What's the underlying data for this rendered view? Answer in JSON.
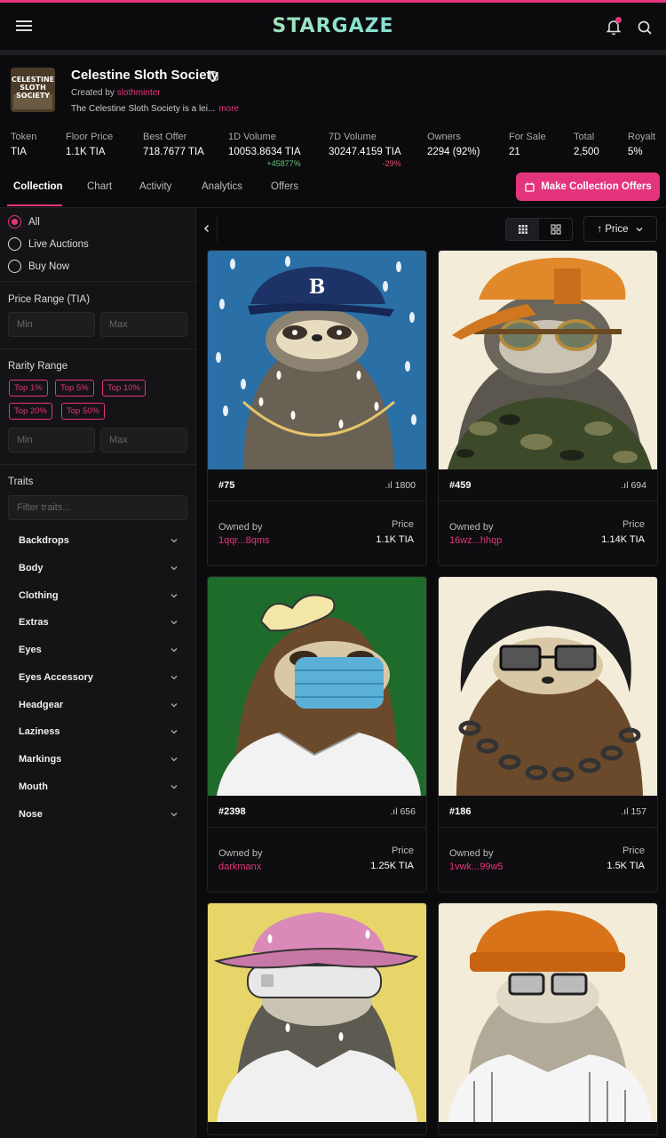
{
  "app": {
    "logo": "STARGAZE"
  },
  "collection": {
    "name": "Celestine Sloth Society",
    "created_by_label": "Created by",
    "creator": "slothminter",
    "description": "The Celestine Sloth Society is a lei...",
    "more_label": "more",
    "avatar_text": "CELESTINE SLOTH SOCIETY"
  },
  "stats": [
    {
      "label": "Token",
      "value": "TIA",
      "change": ""
    },
    {
      "label": "Floor Price",
      "value": "1.1K TIA",
      "change": ""
    },
    {
      "label": "Best Offer",
      "value": "718.7677 TIA",
      "change": ""
    },
    {
      "label": "1D Volume",
      "value": "10053.8634 TIA",
      "change": "+45877%"
    },
    {
      "label": "7D Volume",
      "value": "30247.4159 TIA",
      "change": "-29%"
    },
    {
      "label": "Owners",
      "value": "2294 (92%)",
      "change": ""
    },
    {
      "label": "For Sale",
      "value": "21",
      "change": ""
    },
    {
      "label": "Total",
      "value": "2,500",
      "change": ""
    },
    {
      "label": "Royalt",
      "value": "5%",
      "change": ""
    }
  ],
  "tabs": [
    "Collection",
    "Chart",
    "Activity",
    "Analytics",
    "Offers"
  ],
  "make_offers_label": "Make Collection Offers",
  "filters": {
    "status": [
      "All",
      "Live Auctions",
      "Buy Now"
    ],
    "price_range_title": "Price Range (TIA)",
    "min_placeholder": "Min",
    "max_placeholder": "Max",
    "rarity_title": "Rarity Range",
    "rarity_chips": [
      "Top 1%",
      "Top 5%",
      "Top 10%",
      "Top 20%",
      "Top 50%"
    ],
    "traits_title": "Traits",
    "traits_placeholder": "Filter traits...",
    "traits": [
      "Backdrops",
      "Body",
      "Clothing",
      "Extras",
      "Eyes",
      "Eyes Accessory",
      "Headgear",
      "Laziness",
      "Markings",
      "Mouth",
      "Nose"
    ]
  },
  "sort_label": "Price",
  "cards": [
    {
      "id": "#75",
      "rank": "1800",
      "owned_by_label": "Owned by",
      "owner": "1qqr...8qms",
      "price_label": "Price",
      "price": "1.1K TIA"
    },
    {
      "id": "#459",
      "rank": "694",
      "owned_by_label": "Owned by",
      "owner": "16wz...hhqp",
      "price_label": "Price",
      "price": "1.14K TIA"
    },
    {
      "id": "#2398",
      "rank": "656",
      "owned_by_label": "Owned by",
      "owner": "darkmanx",
      "price_label": "Price",
      "price": "1.25K TIA"
    },
    {
      "id": "#186",
      "rank": "157",
      "owned_by_label": "Owned by",
      "owner": "1vwk...99w5",
      "price_label": "Price",
      "price": "1.5K TIA"
    }
  ],
  "colors": {
    "accent": "#e3347c",
    "positive": "#6cc07a",
    "negative": "#e0506a"
  }
}
